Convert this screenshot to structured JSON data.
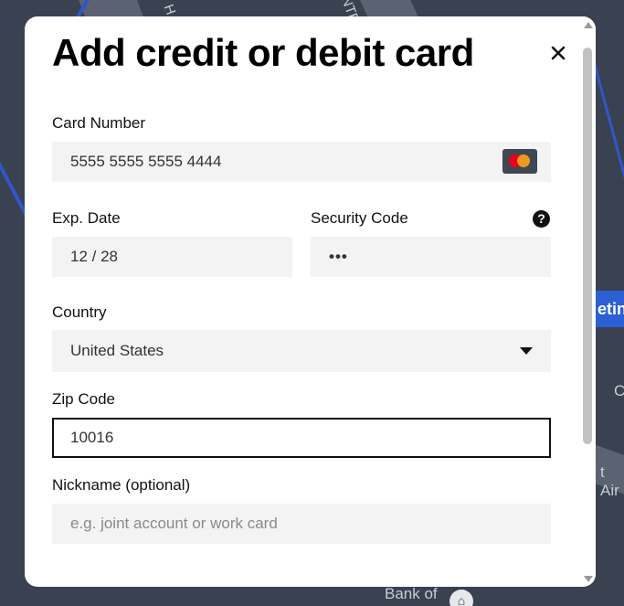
{
  "modal": {
    "title": "Add credit or debit card"
  },
  "icons": {
    "close": "×",
    "help": "?",
    "location": "⌂"
  },
  "map": {
    "street_label_1": "H",
    "street_label_2": "NTE",
    "pill_label": "etin",
    "side_label_1": "C",
    "side_label_2": "t Air",
    "bank_label": "Bank of"
  },
  "card_number": {
    "label": "Card Number",
    "value": "5555 5555 5555 4444",
    "brand": "mastercard-icon"
  },
  "exp_date": {
    "label": "Exp. Date",
    "value": "12 / 28"
  },
  "security_code": {
    "label": "Security Code",
    "value": "•••"
  },
  "country": {
    "label": "Country",
    "value": "United States"
  },
  "zip_code": {
    "label": "Zip Code",
    "value": "10016"
  },
  "nickname": {
    "label": "Nickname (optional)",
    "placeholder": "e.g. joint account or work card"
  },
  "colors": {
    "field_background": "#f3f3f3",
    "focus_border": "#111111",
    "map_background": "#3a4150",
    "map_route": "#2f57c9"
  }
}
